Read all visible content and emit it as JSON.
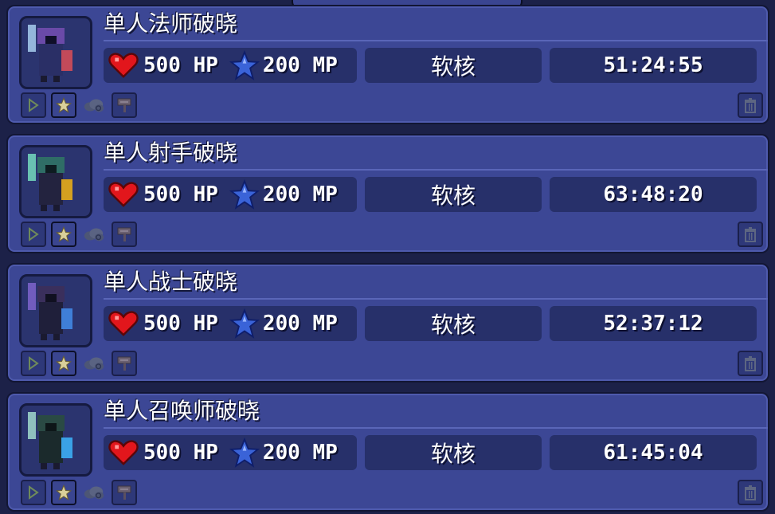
{
  "colors": {
    "background": "#1c2148",
    "card": "#3c4795",
    "stat_box": "#27306a",
    "heart": "#e2161c",
    "star": "#3a63d8"
  },
  "characters": [
    {
      "name": "单人法师破晓",
      "hp": "500 HP",
      "mp": "200 MP",
      "mode": "软核",
      "playtime": "51:24:55"
    },
    {
      "name": "单人射手破晓",
      "hp": "500 HP",
      "mp": "200 MP",
      "mode": "软核",
      "playtime": "63:48:20"
    },
    {
      "name": "单人战士破晓",
      "hp": "500 HP",
      "mp": "200 MP",
      "mode": "软核",
      "playtime": "52:37:12"
    },
    {
      "name": "单人召唤师破晓",
      "hp": "500 HP",
      "mp": "200 MP",
      "mode": "软核",
      "playtime": "61:45:04"
    }
  ],
  "icons": {
    "life": "heart-icon",
    "mana": "mana-star-icon",
    "play": "play-icon",
    "favorite": "favorite-star-icon",
    "cloud": "cloud-save-icon",
    "rename": "signpost-icon",
    "delete": "trash-icon"
  }
}
